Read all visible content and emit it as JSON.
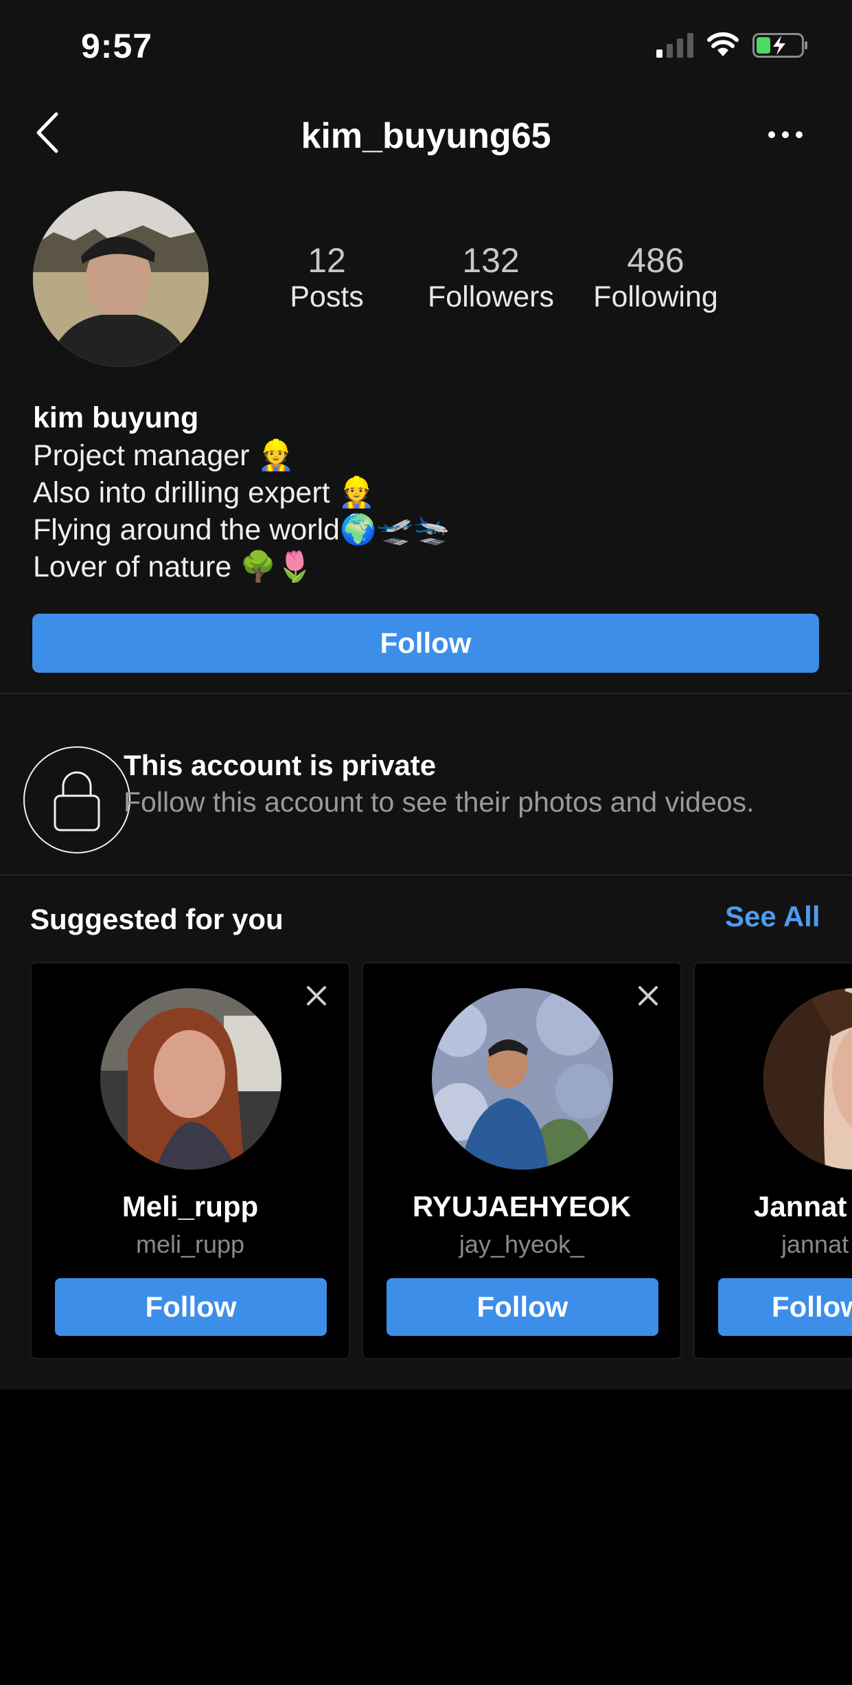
{
  "status_bar": {
    "time": "9:57",
    "signal_icon": "cellular-signal-icon",
    "wifi_icon": "wifi-icon",
    "battery_icon": "battery-charging-icon",
    "battery_color": "#4cd964"
  },
  "header": {
    "back_icon": "chevron-left-icon",
    "title": "kim_buyung65",
    "more_icon": "more-horizontal-icon"
  },
  "profile": {
    "stats": [
      {
        "value": "12",
        "label": "Posts"
      },
      {
        "value": "132",
        "label": "Followers"
      },
      {
        "value": "486",
        "label": "Following"
      }
    ],
    "name": "kim buyung",
    "bio_lines": [
      "Project manager 👷",
      "Also into drilling expert 👷",
      "Flying around the world🌍🛫🛬",
      "Lover of nature 🌳🌷"
    ],
    "follow_label": "Follow"
  },
  "private_notice": {
    "icon": "lock-icon",
    "title": "This account is private",
    "subtitle": "Follow this account to see their photos and videos."
  },
  "suggested": {
    "title": "Suggested for you",
    "see_all": "See All",
    "cards": [
      {
        "name": "Meli_rupp",
        "handle": "meli_rupp",
        "button": "Follow"
      },
      {
        "name": "RYUJAEHYEOK",
        "handle": "jay_hyeok_",
        "button": "Follow"
      },
      {
        "name": "Jannat",
        "handle": "jannat",
        "button": "Follow"
      }
    ]
  },
  "colors": {
    "accent": "#3d8ee8",
    "link": "#4c9cf0",
    "background": "#121212"
  }
}
